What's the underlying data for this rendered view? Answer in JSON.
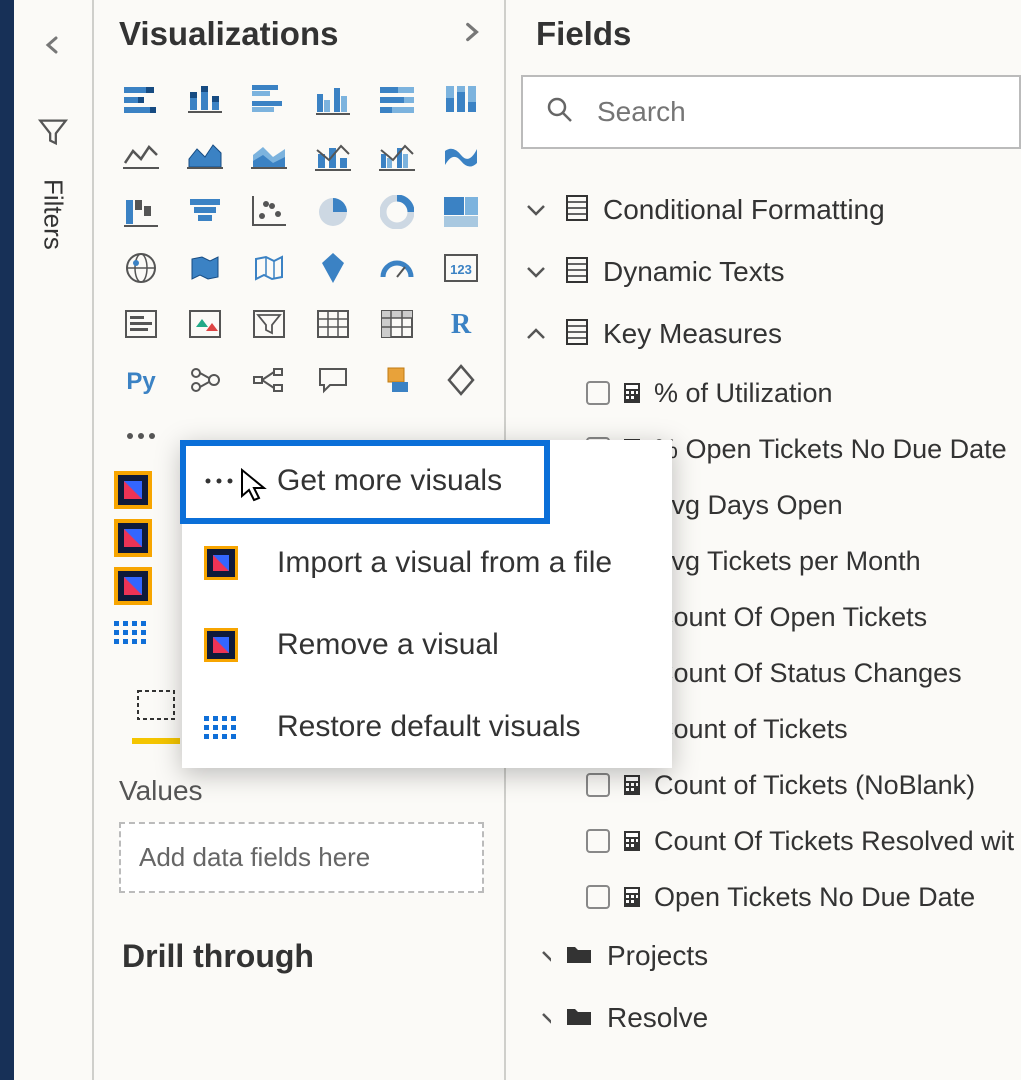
{
  "filters": {
    "label": "Filters"
  },
  "viz": {
    "title": "Visualizations",
    "values_label": "Values",
    "values_placeholder": "Add data fields here",
    "drill_label": "Drill through"
  },
  "context_menu": {
    "get_more": "Get more visuals",
    "import": "Import a visual from a file",
    "remove": "Remove a visual",
    "restore": "Restore default visuals"
  },
  "fields": {
    "title": "Fields",
    "search_placeholder": "Search",
    "tables": [
      {
        "name": "Conditional Formatting",
        "expanded": false,
        "type": "table"
      },
      {
        "name": "Dynamic Texts",
        "expanded": false,
        "type": "table"
      },
      {
        "name": "Key Measures",
        "expanded": true,
        "type": "table",
        "fields": [
          "% of Utilization",
          "% Open Tickets No Due Date",
          "Avg Days Open",
          "Avg Tickets per Month",
          "Count Of Open Tickets",
          "Count Of Status Changes",
          "Count of Tickets",
          "Count of Tickets (NoBlank)",
          "Count Of Tickets Resolved wit",
          "Open Tickets No Due Date"
        ]
      },
      {
        "name": "Projects",
        "expanded": false,
        "type": "folder"
      },
      {
        "name": "Resolve",
        "expanded": false,
        "type": "folder"
      }
    ]
  }
}
